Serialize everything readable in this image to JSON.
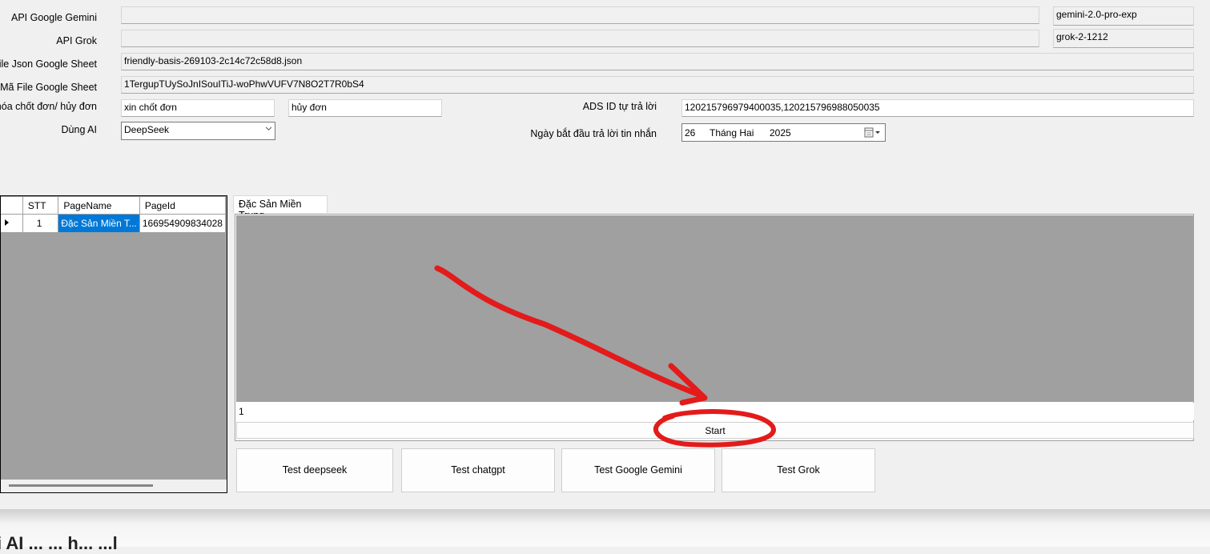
{
  "form": {
    "api_gemini_label": "API Google Gemini",
    "api_gemini_value": "",
    "api_gemini_model": "gemini-2.0-pro-exp",
    "api_grok_label": "API Grok",
    "api_grok_value": "",
    "api_grok_model": "grok-2-1212",
    "json_file_label": "n file Json Google Sheet",
    "json_file_value": "friendly-basis-269103-2c14c72c58d8.json",
    "sheet_code_label": "Mã File Google Sheet",
    "sheet_code_value": "1TergupTUySoJnISouITiJ-woPhwVUFV7N8O2T7R0bS4",
    "keywords_label": "hóa chốt đơn/ hủy đơn",
    "keyword_confirm": "xin chốt đơn",
    "keyword_cancel": "hủy đơn",
    "ai_label": "Dùng AI",
    "ai_selected": "DeepSeek",
    "ads_label": "ADS ID tự trả lời",
    "ads_value": "120215796979400035,120215796988050035",
    "date_label": "Ngày bắt đầu trả lời tin nhắn",
    "date_day": "26",
    "date_month": "Tháng Hai",
    "date_year": "2025"
  },
  "grid": {
    "columns": [
      "",
      "STT",
      "PageName",
      "PageId"
    ],
    "rows": [
      {
        "stt": "1",
        "page_name": "Đặc Sản Miền T...",
        "page_id": "166954909834028"
      }
    ]
  },
  "tabs": [
    {
      "label": "Đặc Sản Miền Trung"
    }
  ],
  "panel": {
    "count_value": "1",
    "start_label": "Start"
  },
  "buttons": {
    "test_deepseek": "Test deepseek",
    "test_chatgpt": "Test chatgpt",
    "test_gemini": "Test Google Gemini",
    "test_grok": "Test Grok"
  },
  "annotation": {
    "color": "#e31b1b"
  },
  "bottom": {
    "text": "i AI ... ... h... ...l"
  }
}
